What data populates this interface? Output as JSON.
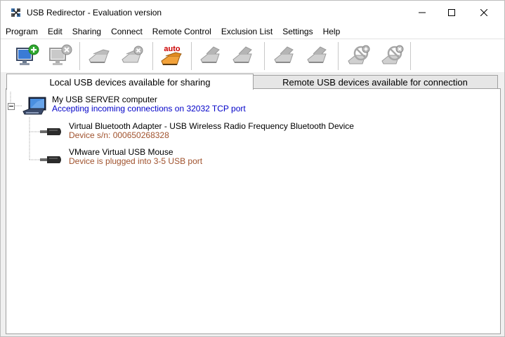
{
  "window": {
    "title": "USB Redirector - Evaluation version",
    "controls": [
      "minimize",
      "maximize",
      "close"
    ]
  },
  "menu": {
    "items": [
      "Program",
      "Edit",
      "Sharing",
      "Connect",
      "Remote Control",
      "Exclusion List",
      "Settings",
      "Help"
    ]
  },
  "toolbar": {
    "auto_label": "auto",
    "buttons": [
      "add-computer-icon",
      "remove-computer-icon",
      "share-device-icon",
      "unshare-device-icon",
      "auto-share-icon",
      "connect-icon",
      "disconnect-icon",
      "connect-all-icon",
      "disconnect-all-icon",
      "add-exclusion-icon",
      "remove-exclusion-icon"
    ]
  },
  "tabs": {
    "local": "Local USB devices available for sharing",
    "remote": "Remote USB devices available for connection"
  },
  "tree": {
    "server": {
      "name": "My USB SERVER computer",
      "status": "Accepting incoming connections on 32032 TCP port"
    },
    "devices": [
      {
        "name": "Virtual Bluetooth Adapter - USB Wireless Radio Frequency Bluetooth Device",
        "detail": "Device s/n: 000650268328"
      },
      {
        "name": "VMware Virtual USB Mouse",
        "detail": "Device is plugged into 3-5 USB port"
      }
    ]
  },
  "colors": {
    "status_blue": "#0000c8",
    "detail_brown": "#a0522d",
    "add_green": "#2fa82f",
    "auto_red": "#cc0000"
  }
}
